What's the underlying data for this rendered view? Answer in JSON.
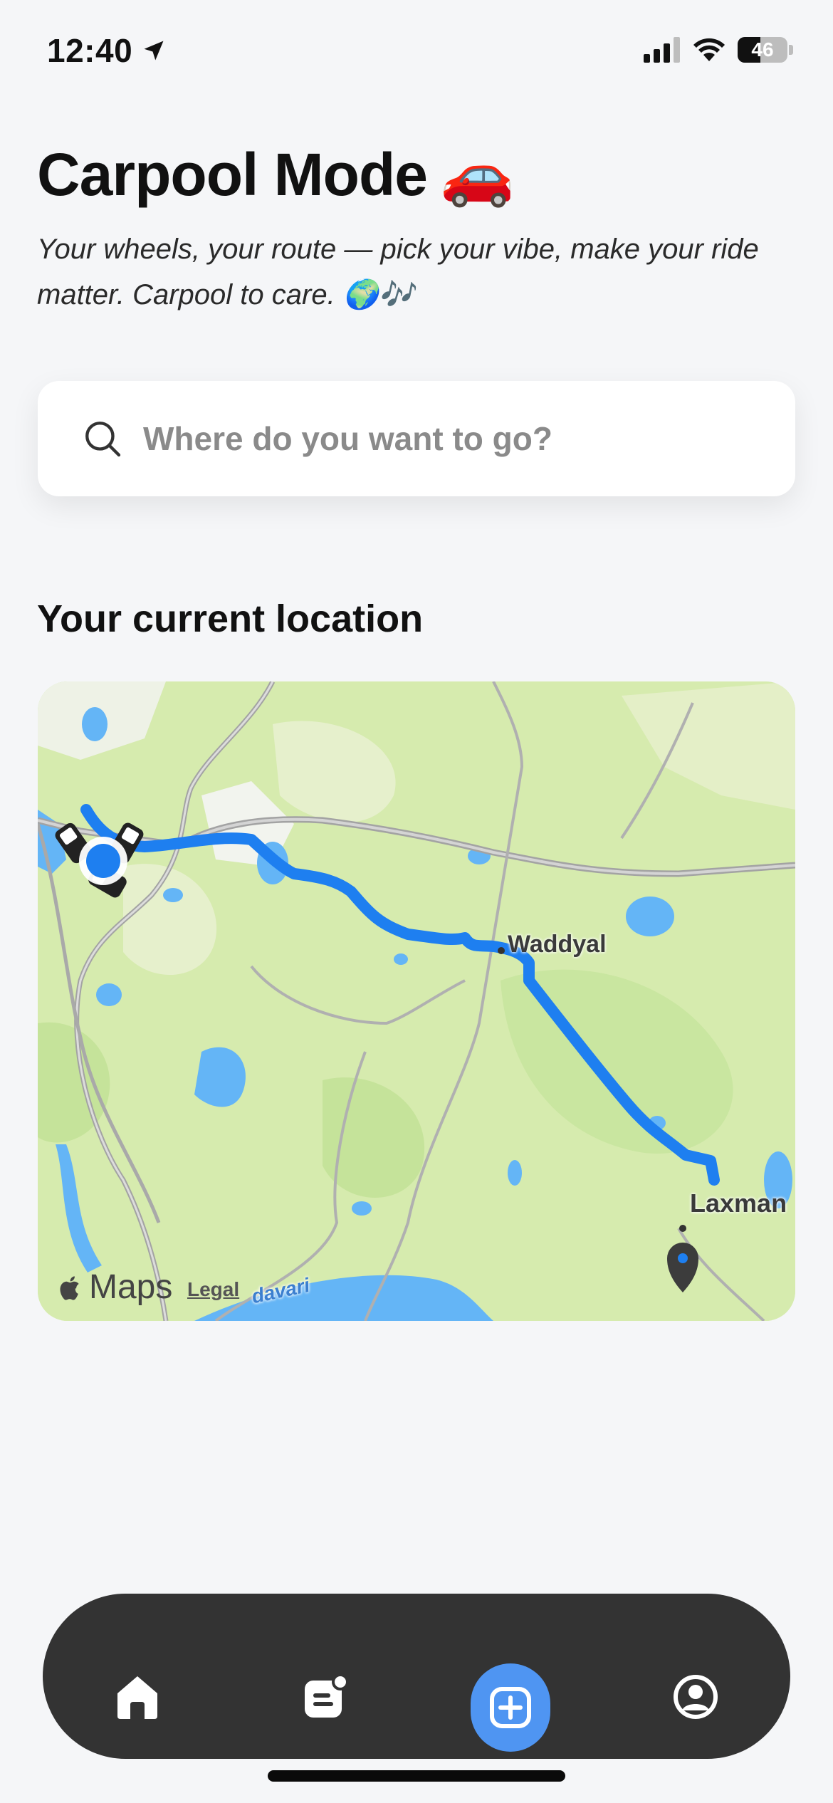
{
  "status_bar": {
    "time": "12:40",
    "battery_level": "46",
    "battery_fraction": 0.46,
    "icons": [
      "location-arrow-icon",
      "cellular-signal-icon",
      "wifi-icon",
      "battery-icon"
    ]
  },
  "header": {
    "title": "Carpool Mode",
    "title_emoji": "🚗",
    "subtitle": "Your wheels, your route — pick your vibe, make your ride matter. Carpool to care. 🌍🎶"
  },
  "search": {
    "placeholder": "Where do you want to go?",
    "value": "",
    "icon": "search-icon"
  },
  "location_section": {
    "title": "Your current location"
  },
  "map": {
    "labels": {
      "town_1": "Waddyal",
      "town_2": "Laxman",
      "river": "davari"
    },
    "attribution": "Maps",
    "legal": "Legal"
  },
  "tab_bar": {
    "tabs": [
      {
        "icon": "home-icon"
      },
      {
        "icon": "news-feed-icon"
      },
      {
        "icon": "add-ride-icon",
        "active": true
      },
      {
        "icon": "profile-icon"
      }
    ],
    "colors": {
      "background": "#333333",
      "accent": "#4f95f2"
    }
  }
}
